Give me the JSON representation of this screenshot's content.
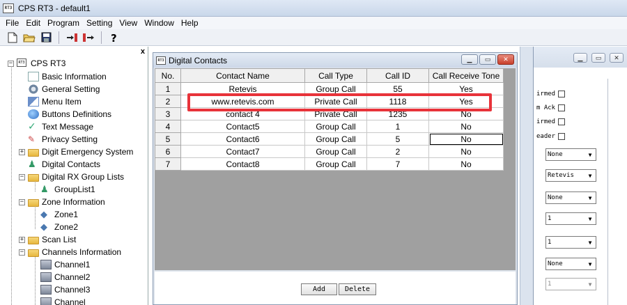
{
  "app": {
    "title": "CPS RT3 - default1",
    "icon_text": "RT3"
  },
  "menu": [
    "File",
    "Edit",
    "Program",
    "Setting",
    "View",
    "Window",
    "Help"
  ],
  "toolbar": {
    "icons": [
      "new-file-icon",
      "open-folder-icon",
      "save-icon",
      "read-radio-icon",
      "write-radio-icon",
      "help-icon"
    ]
  },
  "tree": {
    "close_label": "x",
    "root": "CPS RT3",
    "items": [
      {
        "label": "Basic Information",
        "icon": "document-icon"
      },
      {
        "label": "General Setting",
        "icon": "gear-icon"
      },
      {
        "label": "Menu Item",
        "icon": "menu-icon"
      },
      {
        "label": "Buttons Definitions",
        "icon": "button-icon"
      },
      {
        "label": "Text Message",
        "icon": "message-icon"
      },
      {
        "label": "Privacy Setting",
        "icon": "privacy-icon"
      },
      {
        "label": "Digit Emergency System",
        "icon": "folder-icon"
      },
      {
        "label": "Digital Contacts",
        "icon": "contacts-icon"
      },
      {
        "label": "Digital RX Group Lists",
        "icon": "folder-icon"
      },
      {
        "label": "GroupList1",
        "icon": "group-icon"
      },
      {
        "label": "Zone Information",
        "icon": "folder-icon"
      },
      {
        "label": "Zone1",
        "icon": "zone-icon"
      },
      {
        "label": "Zone2",
        "icon": "zone-icon"
      },
      {
        "label": "Scan List",
        "icon": "folder-icon"
      },
      {
        "label": "Channels Information",
        "icon": "folder-icon"
      },
      {
        "label": "Channel1",
        "icon": "channel-icon"
      },
      {
        "label": "Channel2",
        "icon": "channel-icon"
      },
      {
        "label": "Channel3",
        "icon": "channel-icon"
      },
      {
        "label": "Channel",
        "icon": "channel-icon"
      }
    ]
  },
  "digital_contacts": {
    "title": "Digital Contacts",
    "columns": [
      "No.",
      "Contact Name",
      "Call Type",
      "Call ID",
      "Call Receive Tone"
    ],
    "rows": [
      [
        "1",
        "Retevis",
        "Group Call",
        "55",
        "Yes"
      ],
      [
        "2",
        "www.retevis.com",
        "Private Call",
        "1118",
        "Yes"
      ],
      [
        "3",
        "contact 4",
        "Private Call",
        "1235",
        "No"
      ],
      [
        "4",
        "Contact5",
        "Group Call",
        "1",
        "No"
      ],
      [
        "5",
        "Contact6",
        "Group Call",
        "5",
        "No"
      ],
      [
        "6",
        "Contact7",
        "Group Call",
        "2",
        "No"
      ],
      [
        "7",
        "Contact8",
        "Group Call",
        "7",
        "No"
      ]
    ],
    "add_label": "Add",
    "delete_label": "Delete",
    "highlight_color": "#e8333a"
  },
  "right_panel": {
    "checkboxes": [
      "irmed",
      "m Ack",
      "irmed",
      "eader"
    ],
    "combos": [
      "None",
      "Retevis",
      "None",
      "1",
      "1",
      "None",
      "1"
    ]
  }
}
